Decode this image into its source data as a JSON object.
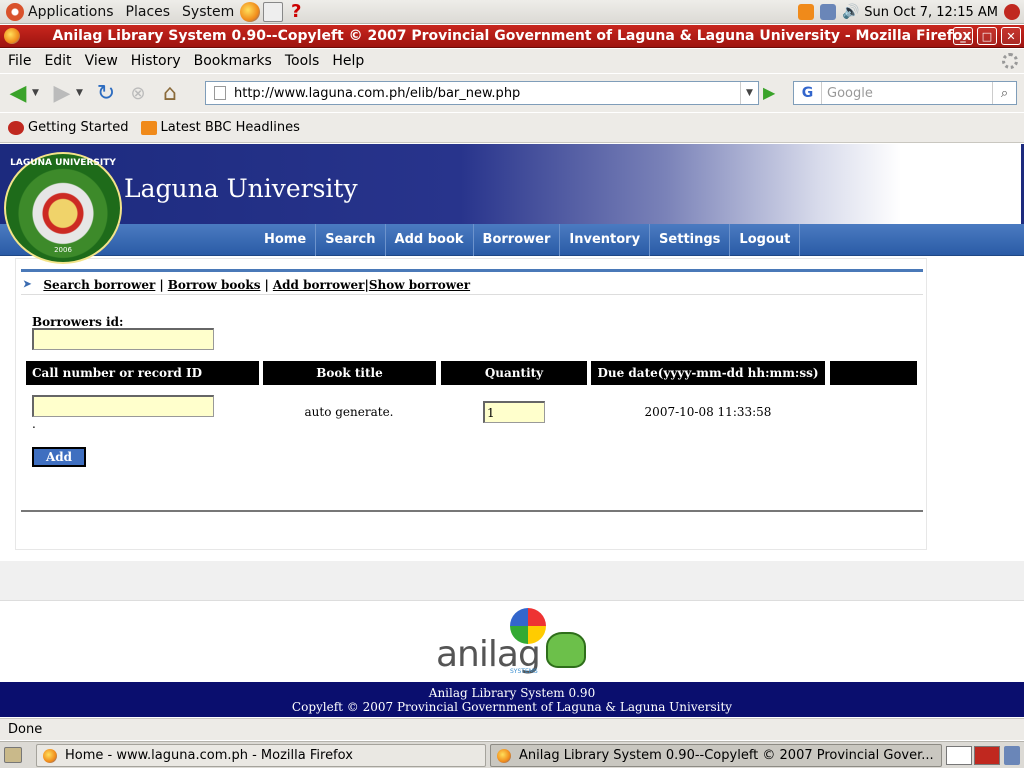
{
  "gnome": {
    "menus": [
      "Applications",
      "Places",
      "System"
    ],
    "clock": "Sun Oct  7, 12:15 AM"
  },
  "window": {
    "title": "Anilag Library System 0.90--Copyleft © 2007 Provincial Government of Laguna & Laguna University - Mozilla Firefox",
    "min": "_",
    "max": "□",
    "close": "✕"
  },
  "firefox": {
    "menu": [
      "File",
      "Edit",
      "View",
      "History",
      "Bookmarks",
      "Tools",
      "Help"
    ],
    "url": "http://www.laguna.com.ph/elib/bar_new.php",
    "search_placeholder": "Google",
    "bookmarks": [
      "Getting Started",
      "Latest BBC Headlines"
    ],
    "status": "Done"
  },
  "site": {
    "logo_text": "LAGUNA UNIVERSITY",
    "logo_year": "2006",
    "name": "Laguna University",
    "nav": [
      "Home",
      "Search",
      "Add book",
      "Borrower",
      "Inventory",
      "Settings",
      "Logout"
    ],
    "subnav": {
      "search": "Search borrower",
      "borrow": "Borrow books ",
      "add": "Add borrower ",
      "show": "Show borrower"
    },
    "form": {
      "borrower_label": "Borrowers id:",
      "borrower_value": "",
      "headers": [
        "Call number or record ID",
        "Book title",
        "Quantity",
        "Due date(yyyy-mm-dd hh:mm:ss)",
        ""
      ],
      "callnum_value": "",
      "dot": ".",
      "book_title": "auto generate.",
      "quantity": "1",
      "due_date": "2007-10-08 11:33:58",
      "add_button": "Add"
    },
    "footer_logo_word": "anilag",
    "footer_logo_sub": "SYSTEMS",
    "footer_line1": "Anilag Library System 0.90",
    "footer_line2": "Copyleft © 2007 Provincial Government of Laguna & Laguna University"
  },
  "taskbar": {
    "tasks": [
      "Home - www.laguna.com.ph - Mozilla Firefox",
      "Anilag Library System 0.90--Copyleft © 2007 Provincial Gover..."
    ]
  },
  "colors": {
    "titlebar": "#b01c16",
    "nav_blue": "#3a6bb5",
    "header_black": "#000000",
    "input_yellow": "#ffffcc",
    "footer_navy": "#0a0e6e"
  }
}
